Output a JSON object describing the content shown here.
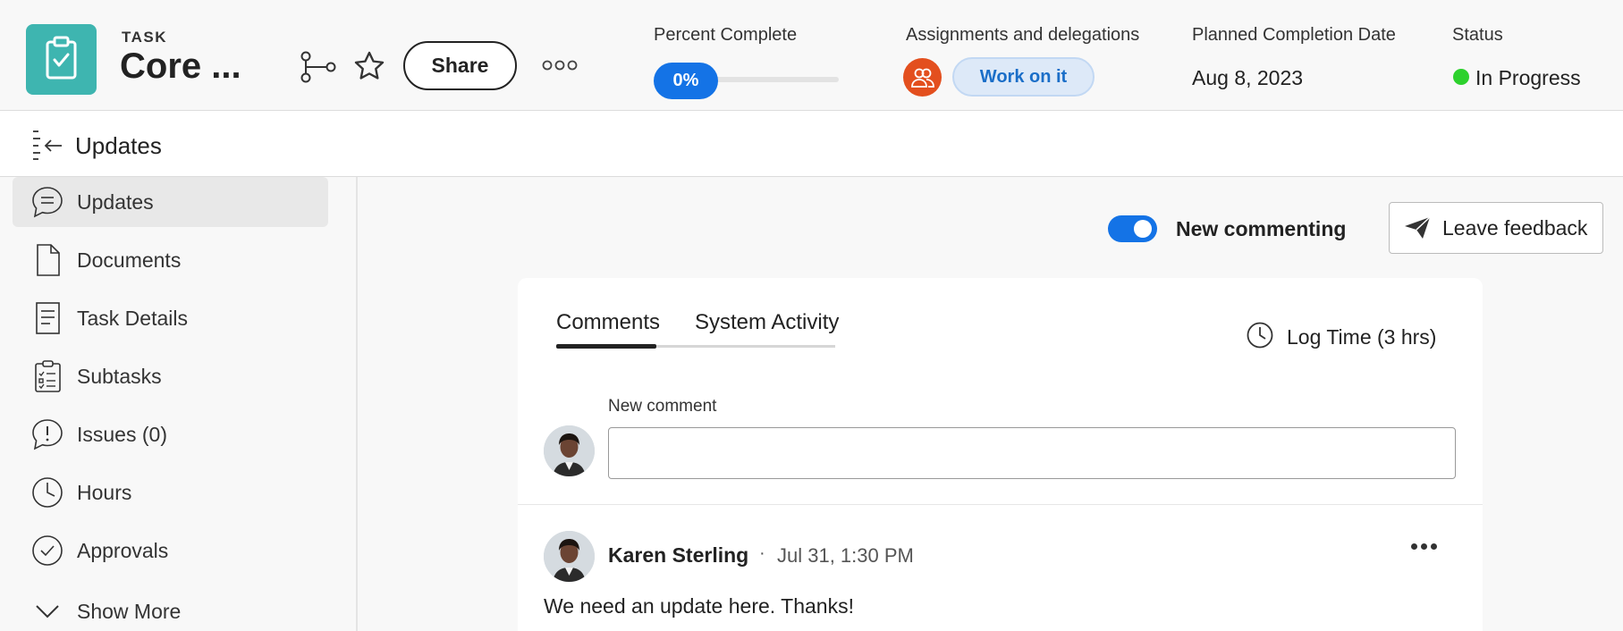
{
  "header": {
    "task_kind": "TASK",
    "task_title": "Core ...",
    "share_label": "Share",
    "percent_label": "Percent Complete",
    "percent_value": "0%",
    "percent_fraction": 0,
    "assign_label": "Assignments and delegations",
    "work_label": "Work on it",
    "planned_label": "Planned Completion Date",
    "planned_value": "Aug 8, 2023",
    "status_label": "Status",
    "status_value": "In Progress",
    "status_color": "#2dd12d",
    "icons": [
      "clipboard-check-icon",
      "hierarchy-icon",
      "star-icon",
      "more-icon"
    ]
  },
  "subheader": {
    "title": "Updates",
    "icon": "collapse-panel-icon"
  },
  "sidebar": {
    "items": [
      {
        "label": "Updates",
        "icon": "speech-bubble-icon",
        "active": true
      },
      {
        "label": "Documents",
        "icon": "document-icon"
      },
      {
        "label": "Task Details",
        "icon": "details-icon"
      },
      {
        "label": "Subtasks",
        "icon": "checklist-icon"
      },
      {
        "label": "Issues (0)",
        "icon": "alert-bubble-icon"
      },
      {
        "label": "Hours",
        "icon": "clock-icon"
      },
      {
        "label": "Approvals",
        "icon": "check-circle-icon"
      },
      {
        "label": "Show More",
        "icon": "chevron-down-icon"
      }
    ]
  },
  "main": {
    "toggle_label": "New commenting",
    "toggle_on": true,
    "feedback_label": "Leave feedback",
    "tabs": [
      {
        "label": "Comments",
        "active": true
      },
      {
        "label": "System Activity",
        "active": false
      }
    ],
    "log_time_label": "Log Time (3 hrs)",
    "new_comment_label": "New comment",
    "new_comment_value": "",
    "comment": {
      "author": "Karen Sterling",
      "separator": "·",
      "time": "Jul 31, 1:30 PM",
      "text": "We need an update here. Thanks!"
    }
  },
  "colors": {
    "accent": "#1473e6",
    "task_icon": "#3eb5b0",
    "assign_avatar": "#e34f1e"
  }
}
